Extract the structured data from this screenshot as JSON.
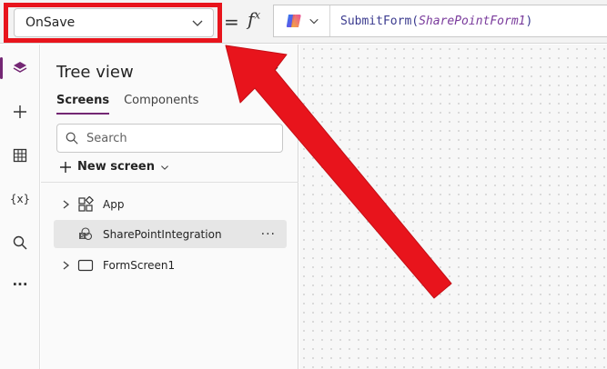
{
  "formula_bar": {
    "property": "OnSave",
    "equals": "=",
    "fx_base": "f",
    "fx_sup": "x",
    "formula_func": "SubmitForm(",
    "formula_arg": "SharePointForm1",
    "formula_close": ")"
  },
  "rail": {
    "variables_label": "{x}",
    "more_label": "···"
  },
  "tree_view": {
    "title": "Tree view",
    "tabs": [
      {
        "label": "Screens",
        "active": true
      },
      {
        "label": "Components",
        "active": false
      }
    ],
    "search_placeholder": "Search",
    "new_screen_label": "New screen",
    "items": [
      {
        "label": "App",
        "icon": "app-icon"
      },
      {
        "label": "SharePointIntegration",
        "icon": "sharepoint-icon",
        "selected": true,
        "more": "···"
      },
      {
        "label": "FormScreen1",
        "icon": "screen-icon"
      }
    ]
  },
  "colors": {
    "accent": "#742774",
    "annotation_red": "#e8141c"
  }
}
